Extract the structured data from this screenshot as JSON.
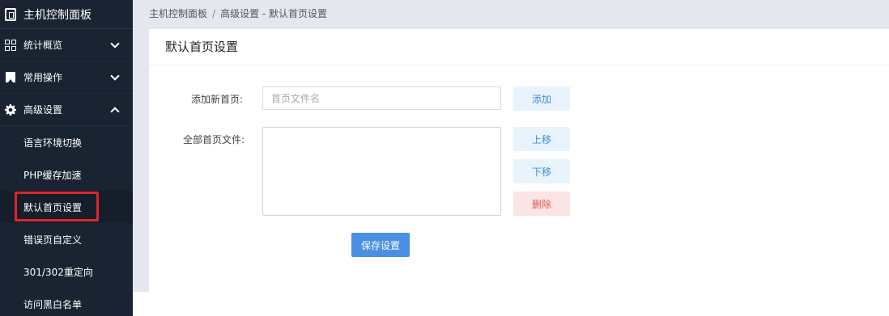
{
  "sidebar": {
    "title": "主机控制面板",
    "groups": [
      {
        "label": "统计概览",
        "icon": "grid-icon",
        "expanded": false
      },
      {
        "label": "常用操作",
        "icon": "bookmark-icon",
        "expanded": false
      },
      {
        "label": "高级设置",
        "icon": "gear-icon",
        "expanded": true
      }
    ],
    "submenu": [
      {
        "label": "语言环境切换"
      },
      {
        "label": "PHP缓存加速"
      },
      {
        "label": "默认首页设置",
        "active": true
      },
      {
        "label": "错误页自定义"
      },
      {
        "label": "301/302重定向"
      },
      {
        "label": "访问黑白名单"
      }
    ]
  },
  "breadcrumb": {
    "root": "主机控制面板",
    "separator": "/",
    "current": "高级设置 - 默认首页设置"
  },
  "panel": {
    "title": "默认首页设置",
    "add_label": "添加新首页:",
    "add_placeholder": "首页文件名",
    "add_value": "",
    "add_button": "添加",
    "list_label": "全部首页文件:",
    "move_up_button": "上移",
    "move_down_button": "下移",
    "delete_button": "删除",
    "save_button": "保存设置"
  },
  "colors": {
    "sidebar_bg": "#1a2332",
    "accent": "#4a90e2",
    "danger": "#e05a5a",
    "highlight_border": "#e0262a"
  }
}
